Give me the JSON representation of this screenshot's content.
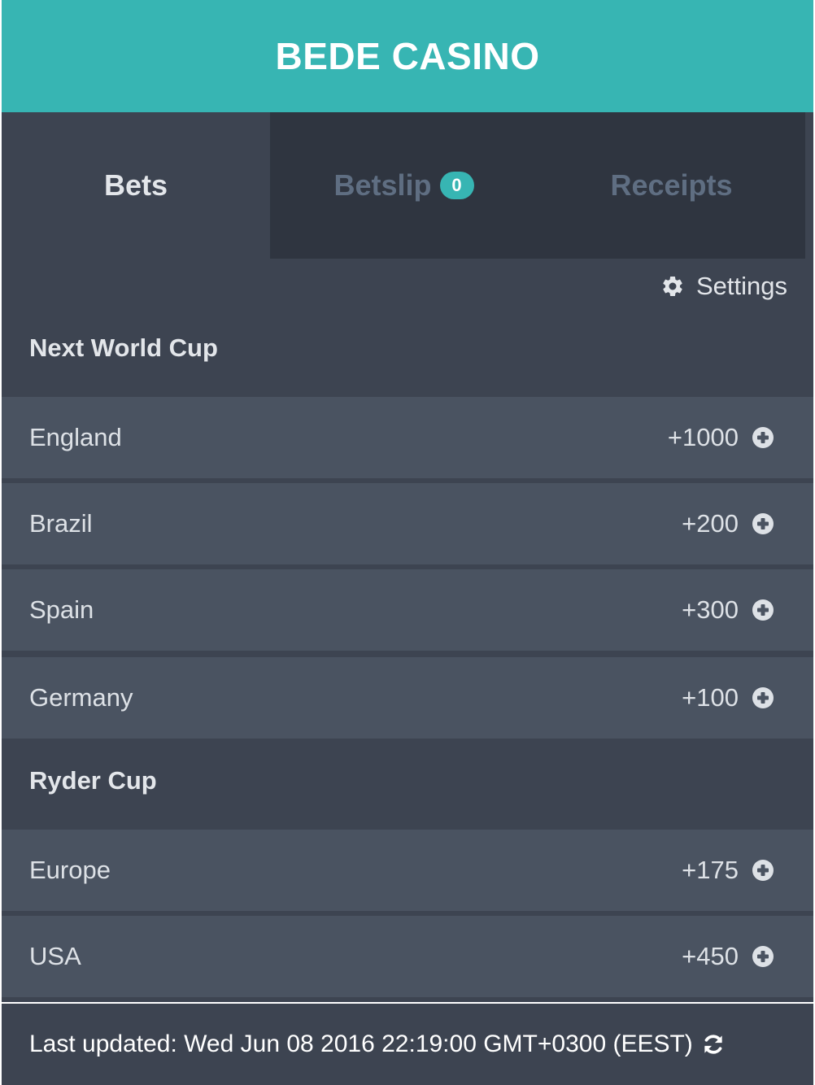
{
  "header": {
    "title": "BEDE CASINO"
  },
  "tabs": {
    "bets_label": "Bets",
    "betslip_label": "Betslip",
    "betslip_count": "0",
    "receipts_label": "Receipts",
    "active": "Bets"
  },
  "settings": {
    "label": "Settings",
    "icon": "gear-icon"
  },
  "groups": [
    {
      "title": "Next World Cup",
      "selections": [
        {
          "name": "England",
          "odds": "+1000"
        },
        {
          "name": "Brazil",
          "odds": "+200"
        },
        {
          "name": "Spain",
          "odds": "+300"
        },
        {
          "name": "Germany",
          "odds": "+100"
        }
      ]
    },
    {
      "title": "Ryder Cup",
      "selections": [
        {
          "name": "Europe",
          "odds": "+175"
        },
        {
          "name": "USA",
          "odds": "+450"
        }
      ]
    }
  ],
  "footer": {
    "last_updated": "Last updated: Wed Jun 08 2016 22:19:00 GMT+0300 (EEST)",
    "refresh_icon": "refresh-icon"
  },
  "colors": {
    "accent": "#37b5b3",
    "panel": "#3d4451",
    "row": "#4a5361",
    "inactive_tab": "#2f3540"
  }
}
